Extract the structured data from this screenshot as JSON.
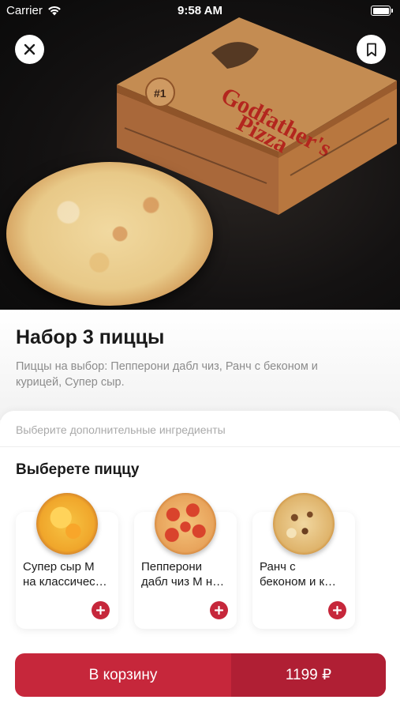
{
  "status_bar": {
    "carrier": "Carrier",
    "time": "9:58 AM"
  },
  "hero": {
    "box_brand_line1": "Godfather's",
    "box_brand_line2": "Pizza",
    "box_badge": "#1"
  },
  "product": {
    "title": "Набор 3 пиццы",
    "description": "Пиццы на выбор: Пепперони дабл чиз, Ранч с беконом и курицей, Супер сыр."
  },
  "options": {
    "ingredients_hint": "Выберите дополнительные ингредиенты",
    "section_title": "Выберете пиццу",
    "pizzas": [
      {
        "line1": "Супер сыр М",
        "line2": "на классичес…",
        "image": "cheese-pizza"
      },
      {
        "line1": "Пепперони",
        "line2": "дабл чиз М н…",
        "image": "pepperoni-pizza"
      },
      {
        "line1": "Ранч с",
        "line2": "беконом и к…",
        "image": "ranch-pizza"
      }
    ]
  },
  "cart": {
    "label": "В корзину",
    "price": "1199 ₽"
  },
  "colors": {
    "accent": "#c6273b",
    "accent_dark": "#b01f34"
  }
}
